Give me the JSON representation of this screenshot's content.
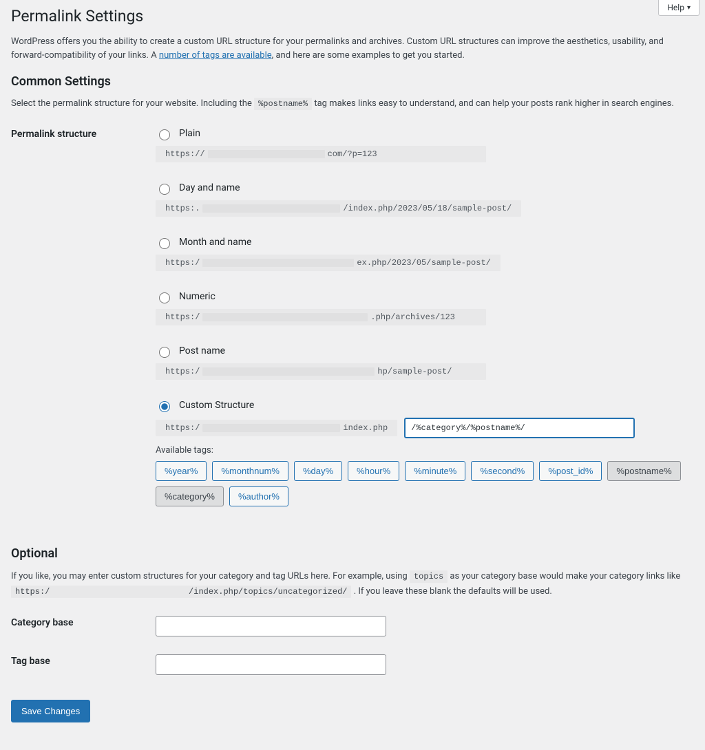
{
  "help_label": "Help",
  "page_title": "Permalink Settings",
  "intro": {
    "pre": "WordPress offers you the ability to create a custom URL structure for your permalinks and archives. Custom URL structures can improve the aesthetics, usability, and forward-compatibility of your links. A ",
    "link": "number of tags are available",
    "post": ", and here are some examples to get you started."
  },
  "common": {
    "heading": "Common Settings",
    "desc_pre": "Select the permalink structure for your website. Including the ",
    "desc_tag": "%postname%",
    "desc_post": " tag makes links easy to understand, and can help your posts rank higher in search engines."
  },
  "structure": {
    "row_label": "Permalink structure",
    "options": {
      "plain": {
        "label": "Plain",
        "example_prefix": "https://",
        "example_suffix": "com/?p=123"
      },
      "day": {
        "label": "Day and name",
        "example_prefix": "https:.",
        "example_suffix": "/index.php/2023/05/18/sample-post/"
      },
      "month": {
        "label": "Month and name",
        "example_prefix": "https:/",
        "example_suffix": "ex.php/2023/05/sample-post/"
      },
      "numeric": {
        "label": "Numeric",
        "example_prefix": "https:/",
        "example_suffix": ".php/archives/123"
      },
      "postname": {
        "label": "Post name",
        "example_prefix": "https:/",
        "example_suffix": "hp/sample-post/"
      },
      "custom": {
        "label": "Custom Structure",
        "prefix": "https:/",
        "suffix": "index.php",
        "value": "/%category%/%postname%/"
      }
    },
    "available_label": "Available tags:",
    "tags": [
      {
        "text": "%year%",
        "active": false
      },
      {
        "text": "%monthnum%",
        "active": false
      },
      {
        "text": "%day%",
        "active": false
      },
      {
        "text": "%hour%",
        "active": false
      },
      {
        "text": "%minute%",
        "active": false
      },
      {
        "text": "%second%",
        "active": false
      },
      {
        "text": "%post_id%",
        "active": false
      },
      {
        "text": "%postname%",
        "active": true
      },
      {
        "text": "%category%",
        "active": true
      },
      {
        "text": "%author%",
        "active": false
      }
    ]
  },
  "optional": {
    "heading": "Optional",
    "desc_pre": "If you like, you may enter custom structures for your category and tag URLs here. For example, using ",
    "desc_tag": "topics",
    "desc_mid": " as your category base would make your category links like ",
    "desc_url": "https:/                            /index.php/topics/uncategorized/",
    "desc_post": " . If you leave these blank the defaults will be used.",
    "category_label": "Category base",
    "tag_label": "Tag base"
  },
  "save_label": "Save Changes"
}
